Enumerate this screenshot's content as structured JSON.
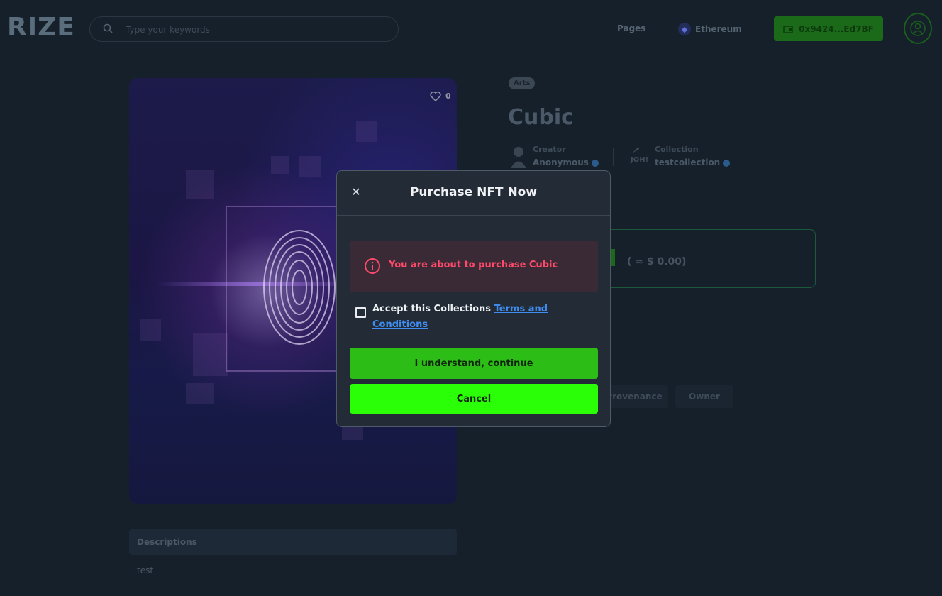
{
  "header": {
    "logo": "RIZE",
    "search_placeholder": "Type your keywords",
    "nav_pages": "Pages",
    "network": "Ethereum",
    "wallet_address": "0x9424...Ed7BF"
  },
  "nft": {
    "likes": "0",
    "tag": "Arts",
    "title": "Cubic",
    "creator_label": "Creator",
    "creator_name": "Anonymous",
    "collection_label": "Collection",
    "collection_icon_text": "JOH!",
    "collection_name": "testcollection",
    "price_usd": "( ≈ $ 0.00)",
    "tabs": [
      "Provenance",
      "Owner"
    ],
    "descriptions_label": "Descriptions",
    "description_text": "test"
  },
  "modal": {
    "title": "Purchase NFT Now",
    "warning": "You are about to purchase Cubic",
    "accept_prefix": "Accept this Collections ",
    "accept_link_1": "Terms and",
    "accept_link_2": "Conditions",
    "continue_label": "I understand, continue",
    "cancel_label": "Cancel"
  },
  "colors": {
    "background": "#16202b",
    "modal_bg": "#222b36",
    "warning_text": "#ff4a6a",
    "continue_btn": "#2cbd16",
    "cancel_btn": "#2bff07",
    "link": "#3f8df0"
  }
}
